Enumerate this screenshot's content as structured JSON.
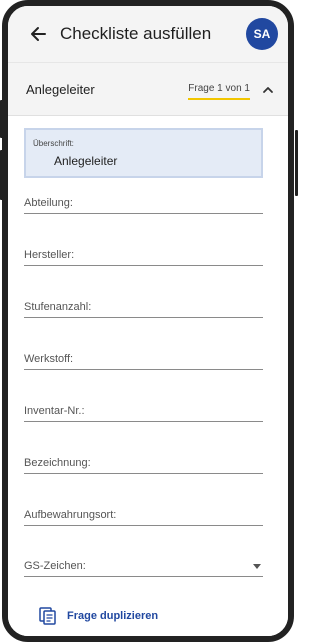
{
  "header": {
    "title": "Checkliste ausfüllen",
    "avatar_initials": "SA"
  },
  "section": {
    "title": "Anlegeleiter",
    "question_counter": "Frage 1 von 1"
  },
  "heading_field": {
    "label": "Überschrift:",
    "value": "Anlegeleiter"
  },
  "fields": [
    {
      "label": "Abteilung:"
    },
    {
      "label": "Hersteller:"
    },
    {
      "label": "Stufenanzahl:"
    },
    {
      "label": "Werkstoff:"
    },
    {
      "label": "Inventar-Nr.:"
    },
    {
      "label": "Bezeichnung:"
    },
    {
      "label": "Aufbewahrungsort:"
    },
    {
      "label": "GS-Zeichen:",
      "type": "dropdown"
    }
  ],
  "actions": {
    "duplicate_label": "Frage duplizieren"
  },
  "colors": {
    "accent": "#2148a0",
    "highlight": "#f2c600",
    "heading_bg": "#e4ebf6"
  }
}
